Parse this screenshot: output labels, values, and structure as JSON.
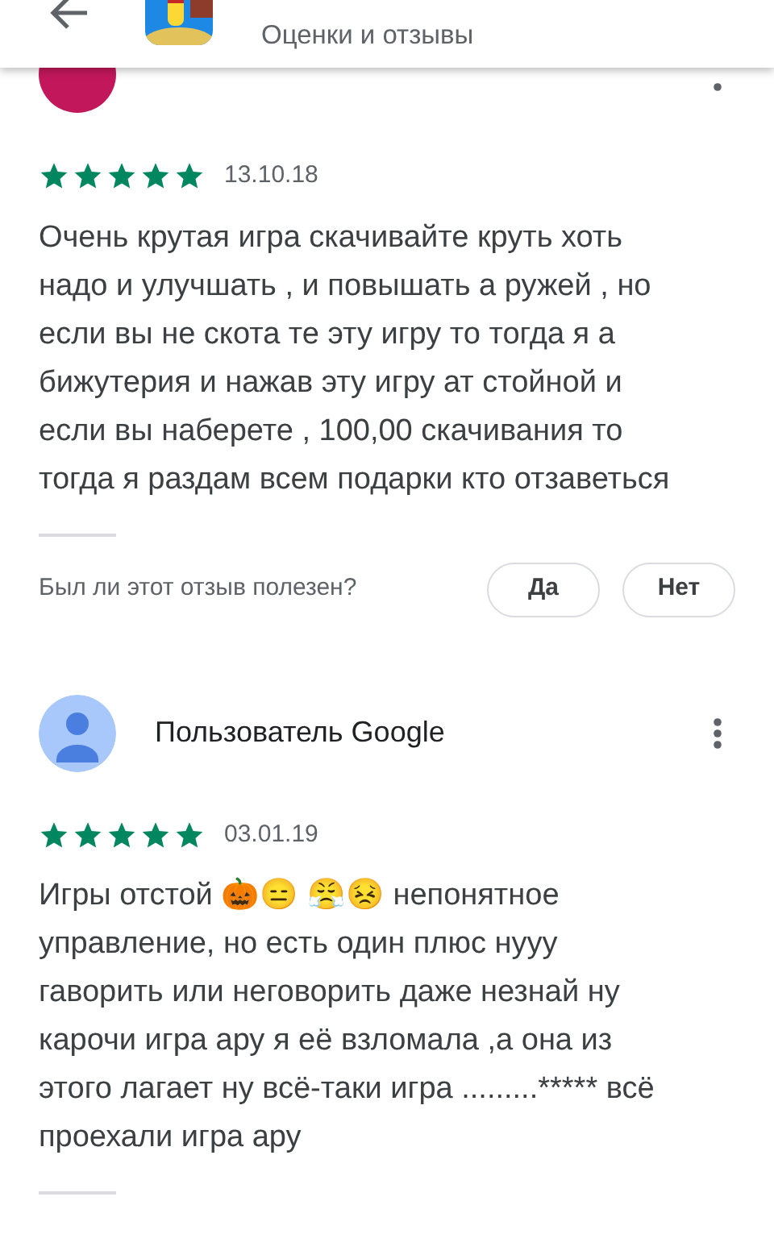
{
  "header": {
    "subtitle": "Оценки и отзывы"
  },
  "reviews": [
    {
      "kind": "circle",
      "color": "#c2185b",
      "stars": 5,
      "date": "13.10.18",
      "text": "Очень крутая игра скачивайте круть хоть надо и улучшать , и повышать а ружей , но если вы не скота те эту игру то тогда я а бижутерия и нажав эту игру ат стойной и если вы наберете , 100,00 скачивания то тогда я раздам всем подарки кто отзаветься",
      "question": "Был ли этот отзыв полезен?",
      "buttons": [
        "Да",
        "Нет"
      ]
    },
    {
      "author": "Пользователь Google",
      "kind": "person",
      "color": "#a8c7fa",
      "stars": 5,
      "date": "03.01.19",
      "text": "Игры отстой 🎃😑 😤😣 непонятное управление, но есть один плюс нууу гаворить или неговорить даже незнай ну карочи игра ару я её взломала ,а она из этого лагает ну всё-таки игра .........***** всё проехали игра ару"
    }
  ]
}
